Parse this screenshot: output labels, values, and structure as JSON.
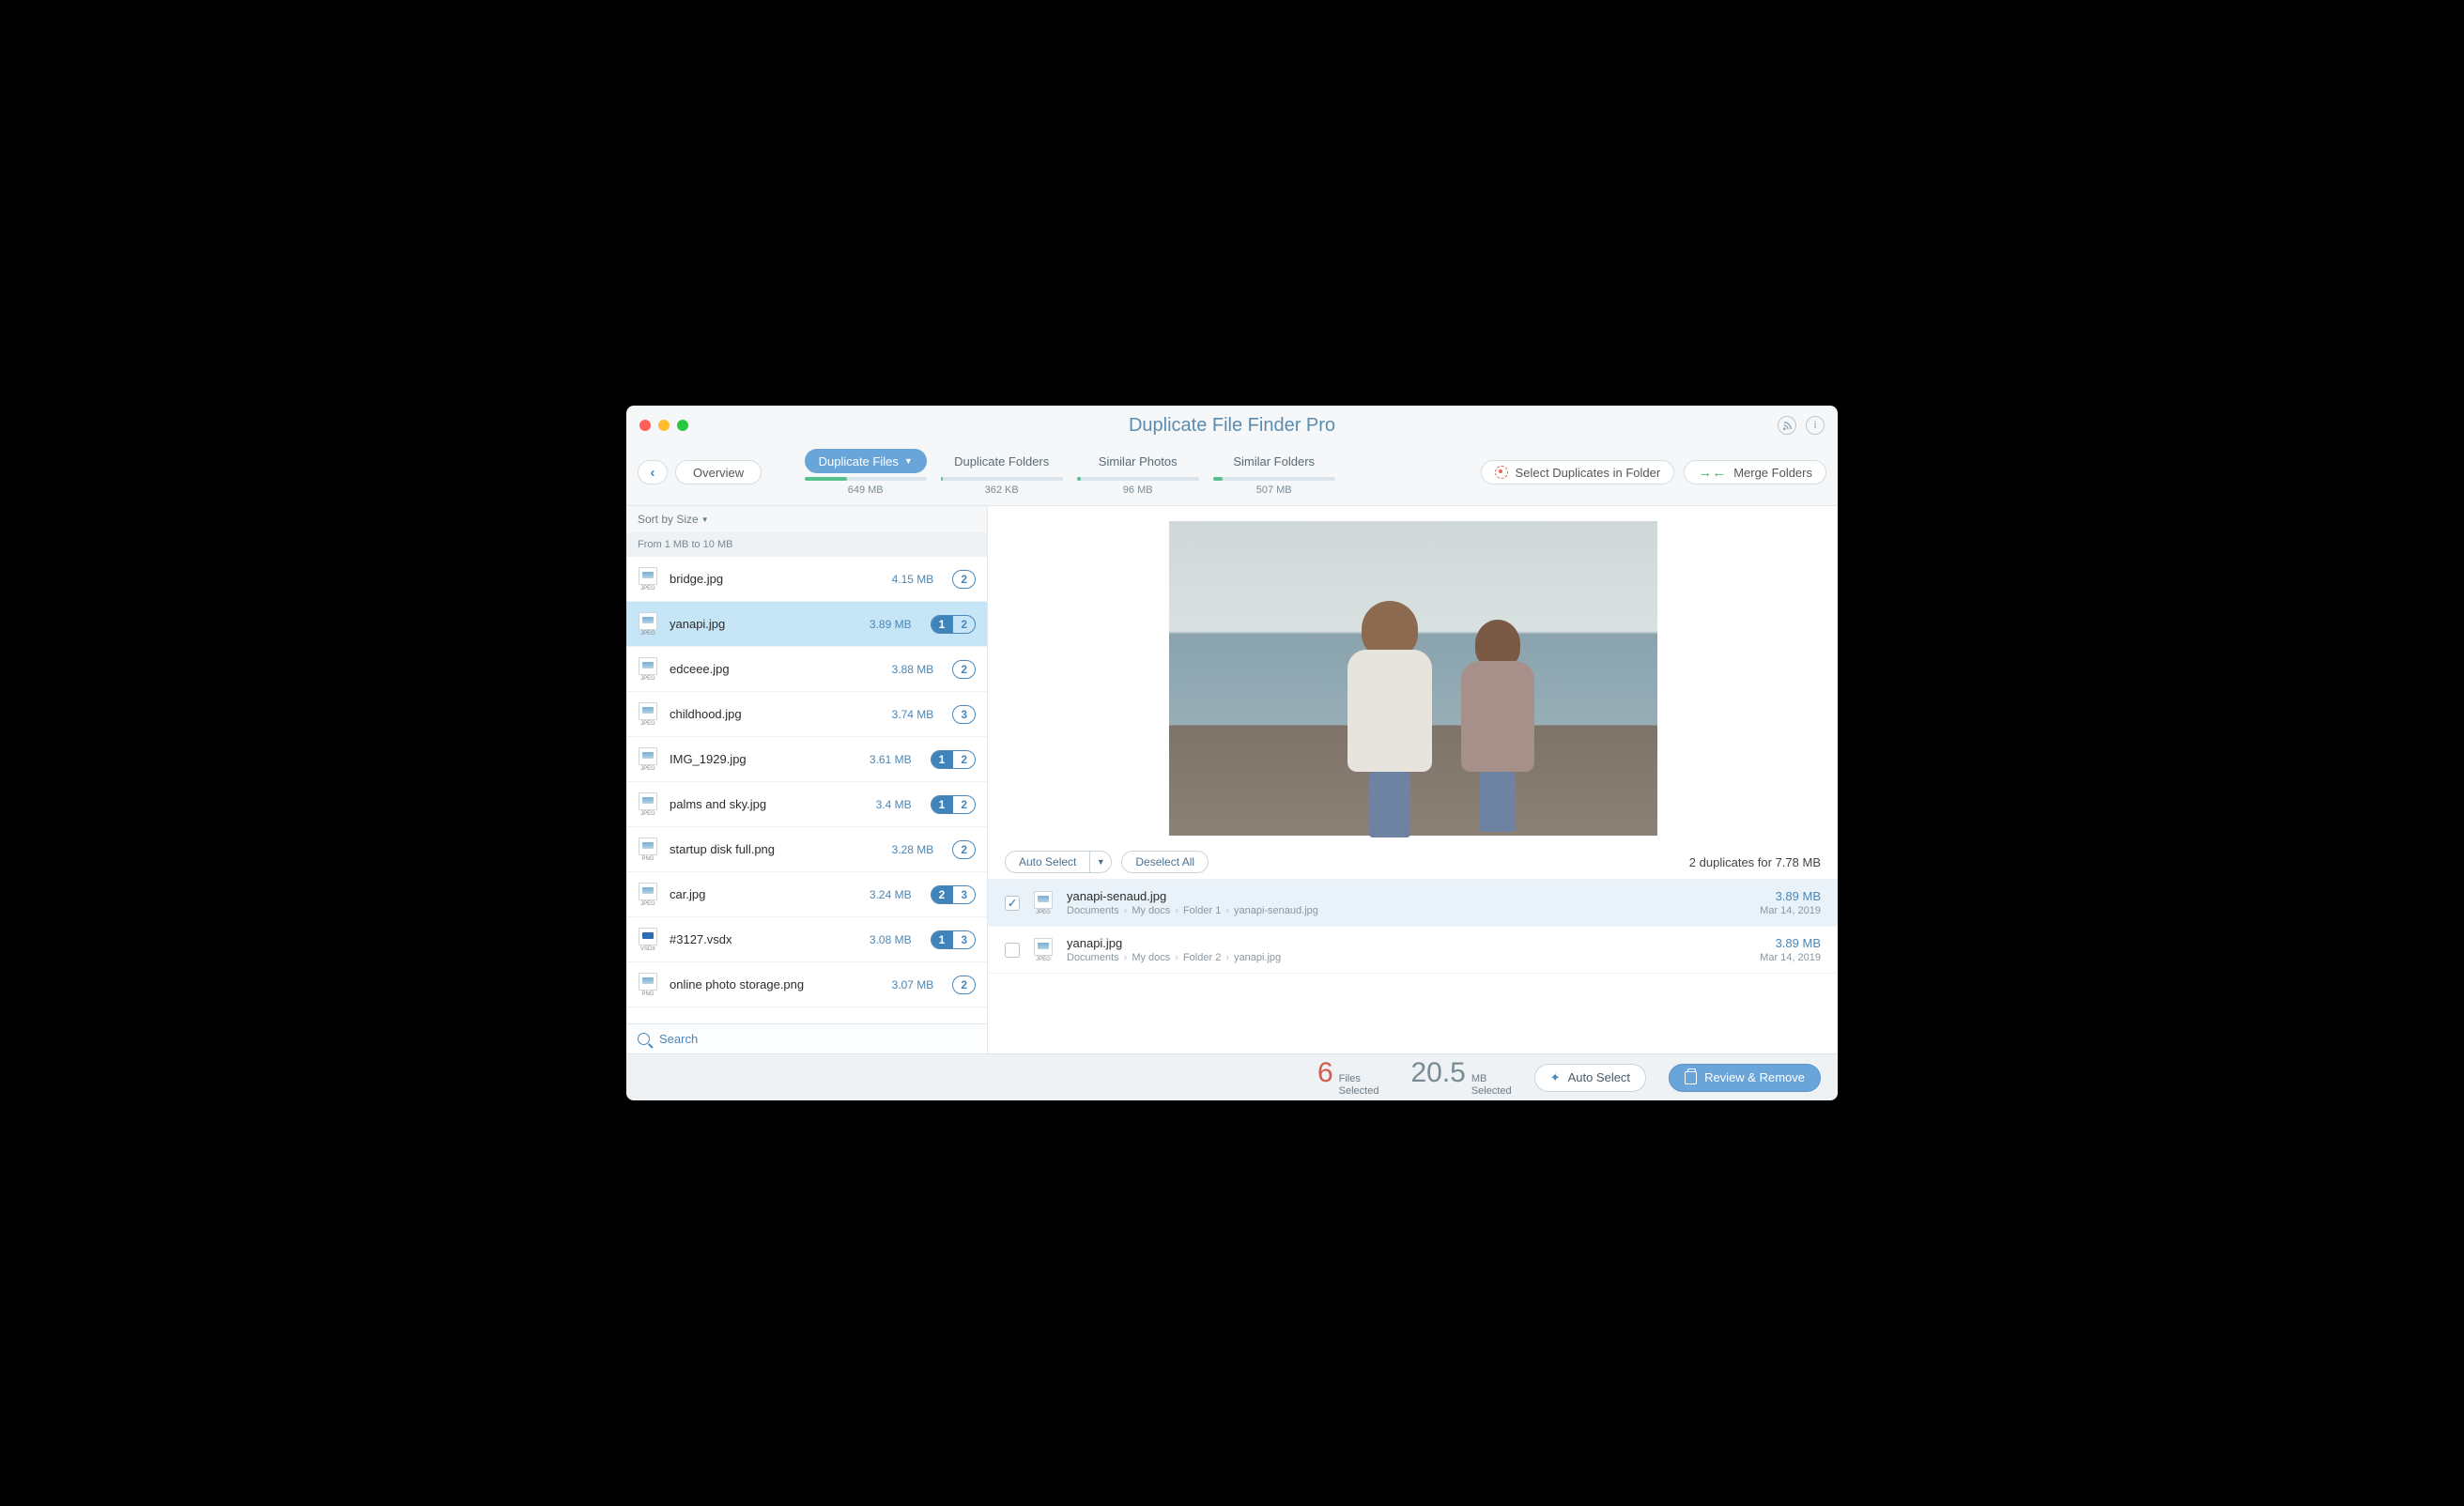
{
  "window": {
    "title": "Duplicate File Finder Pro"
  },
  "toolbar": {
    "overview": "Overview",
    "select_dup_folder": "Select Duplicates in Folder",
    "merge_folders": "Merge Folders"
  },
  "tabs": [
    {
      "label": "Duplicate Files",
      "size": "649 MB",
      "fill": 35,
      "active": true
    },
    {
      "label": "Duplicate Folders",
      "size": "362 KB",
      "fill": 2,
      "active": false
    },
    {
      "label": "Similar Photos",
      "size": "96 MB",
      "fill": 3,
      "active": false
    },
    {
      "label": "Similar Folders",
      "size": "507 MB",
      "fill": 8,
      "active": false
    }
  ],
  "sidebar": {
    "sort_label": "Sort by Size",
    "group_header": "From 1 MB to 10 MB",
    "search": "Search",
    "files": [
      {
        "name": "bridge.jpg",
        "size": "4.15 MB",
        "type": "JPEG",
        "badges": [
          "2"
        ],
        "sel": [],
        "selected": false
      },
      {
        "name": "yanapi.jpg",
        "size": "3.89 MB",
        "type": "JPEG",
        "badges": [
          "1",
          "2"
        ],
        "sel": [
          "1"
        ],
        "selected": true
      },
      {
        "name": "edceee.jpg",
        "size": "3.88 MB",
        "type": "JPEG",
        "badges": [
          "2"
        ],
        "sel": [],
        "selected": false
      },
      {
        "name": "childhood.jpg",
        "size": "3.74 MB",
        "type": "JPEG",
        "badges": [
          "3"
        ],
        "sel": [],
        "selected": false
      },
      {
        "name": "IMG_1929.jpg",
        "size": "3.61 MB",
        "type": "JPEG",
        "badges": [
          "1",
          "2"
        ],
        "sel": [
          "1"
        ],
        "selected": false
      },
      {
        "name": "palms and sky.jpg",
        "size": "3.4 MB",
        "type": "JPEG",
        "badges": [
          "1",
          "2"
        ],
        "sel": [
          "1"
        ],
        "selected": false
      },
      {
        "name": "startup disk full.png",
        "size": "3.28 MB",
        "type": "PNG",
        "badges": [
          "2"
        ],
        "sel": [],
        "selected": false
      },
      {
        "name": "car.jpg",
        "size": "3.24 MB",
        "type": "JPEG",
        "badges": [
          "2",
          "3"
        ],
        "sel": [
          "2"
        ],
        "selected": false
      },
      {
        "name": "#3127.vsdx",
        "size": "3.08 MB",
        "type": "VSDX",
        "badges": [
          "1",
          "3"
        ],
        "sel": [
          "1"
        ],
        "selected": false
      },
      {
        "name": "online photo storage.png",
        "size": "3.07 MB",
        "type": "PNG",
        "badges": [
          "2"
        ],
        "sel": [],
        "selected": false
      }
    ]
  },
  "actions": {
    "auto_select": "Auto Select",
    "deselect_all": "Deselect All",
    "summary": "2 duplicates for 7.78 MB"
  },
  "duplicates": [
    {
      "name": "yanapi-senaud.jpg",
      "path": [
        "Documents",
        "My docs",
        "Folder 1",
        "yanapi-senaud.jpg"
      ],
      "size": "3.89 MB",
      "date": "Mar 14, 2019",
      "checked": true
    },
    {
      "name": "yanapi.jpg",
      "path": [
        "Documents",
        "My docs",
        "Folder 2",
        "yanapi.jpg"
      ],
      "size": "3.89 MB",
      "date": "Mar 14, 2019",
      "checked": false
    }
  ],
  "footer": {
    "files_count": "6",
    "files_label1": "Files",
    "files_label2": "Selected",
    "mb_count": "20.5",
    "mb_label1": "MB",
    "mb_label2": "Selected",
    "auto_select": "Auto Select",
    "review_remove": "Review & Remove"
  }
}
